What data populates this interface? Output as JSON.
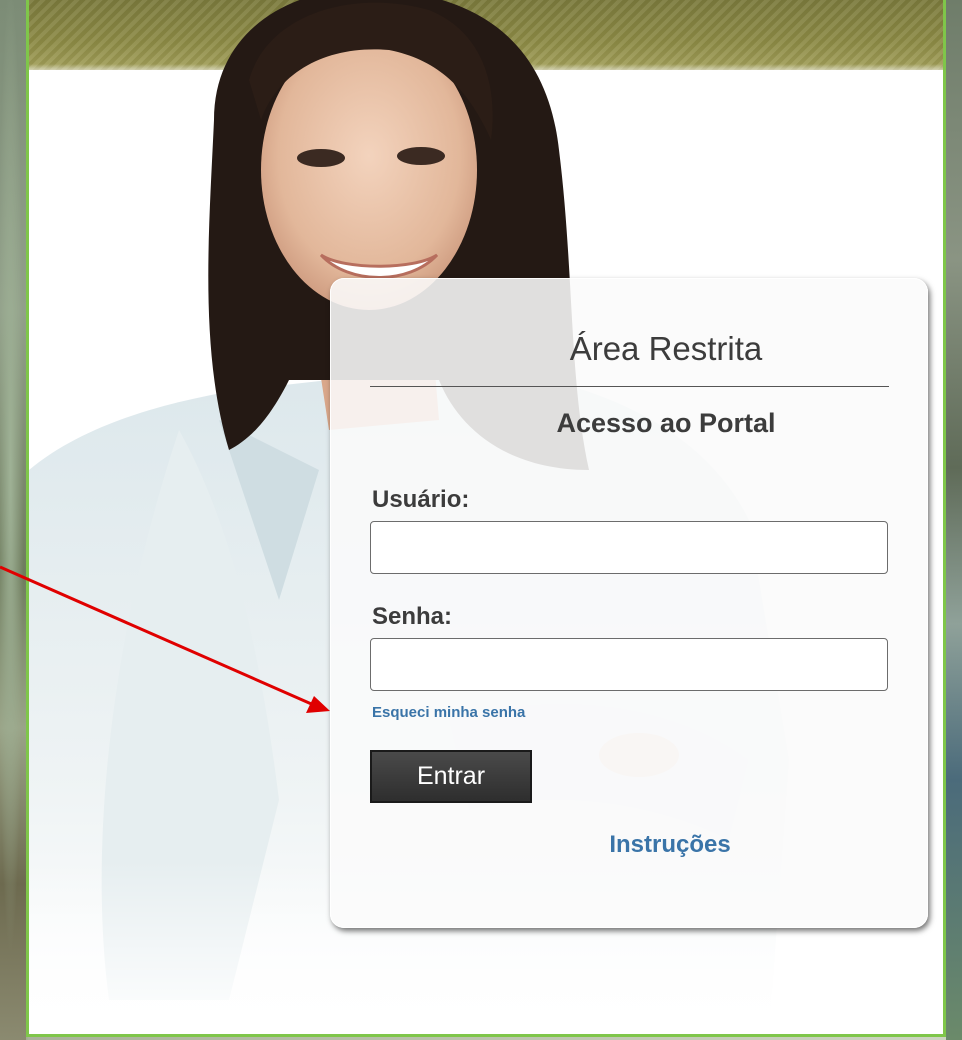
{
  "login": {
    "title": "Área Restrita",
    "subtitle": "Acesso ao Portal",
    "username_label": "Usuário:",
    "username_value": "",
    "password_label": "Senha:",
    "password_value": "",
    "forgot_password": "Esqueci minha senha",
    "submit": "Entrar",
    "instructions": "Instruções"
  },
  "colors": {
    "frame_border": "#7fc64a",
    "header_band": "#8c8a45",
    "link": "#3a74a8",
    "annotation_arrow": "#e00000",
    "button_bg": "#333333"
  },
  "icons": {
    "annotation": "red-arrow-icon"
  }
}
